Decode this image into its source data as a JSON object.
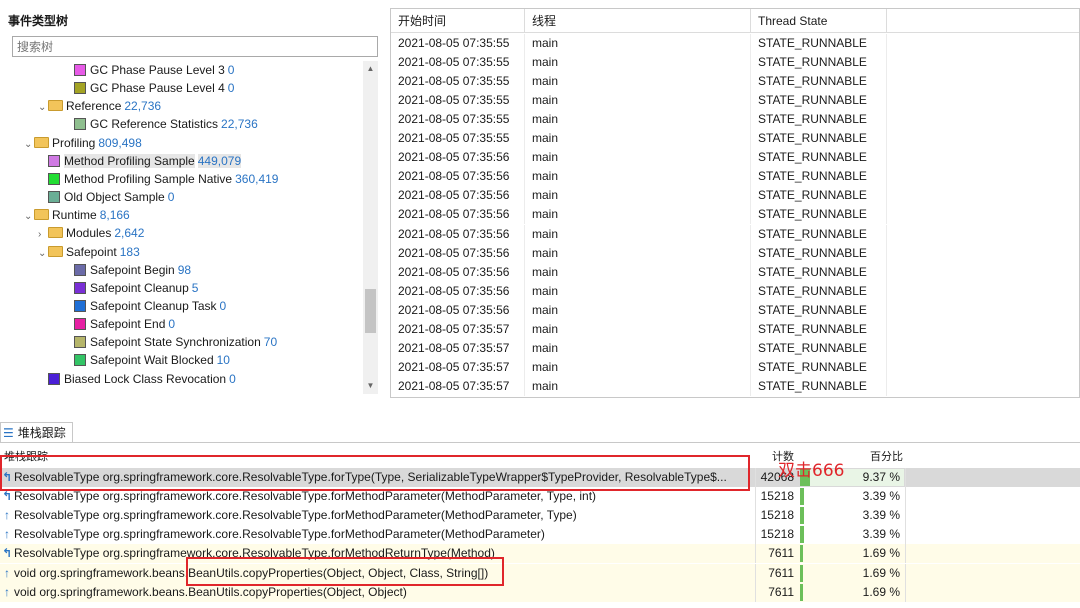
{
  "tree": {
    "title": "事件类型树",
    "search_placeholder": "搜索树",
    "nodes": [
      {
        "indent": 3,
        "kind": "swatch",
        "color": "#e65ae6",
        "label": "GC Phase Pause Level 3",
        "count": "0"
      },
      {
        "indent": 3,
        "kind": "swatch",
        "color": "#a3a324",
        "label": "GC Phase Pause Level 4",
        "count": "0"
      },
      {
        "indent": 2,
        "kind": "folder",
        "arrow": "v",
        "label": "Reference",
        "count": "22,736"
      },
      {
        "indent": 3,
        "kind": "swatch",
        "color": "#8fbf8f",
        "label": "GC Reference Statistics",
        "count": "22,736"
      },
      {
        "indent": 1,
        "kind": "folder",
        "arrow": "v",
        "label": "Profiling",
        "count": "809,498"
      },
      {
        "indent": 2,
        "kind": "swatch",
        "color": "#cf79e3",
        "label": "Method Profiling Sample",
        "count": "449,079",
        "selected": true
      },
      {
        "indent": 2,
        "kind": "swatch",
        "color": "#22dd33",
        "label": "Method Profiling Sample Native",
        "count": "360,419"
      },
      {
        "indent": 2,
        "kind": "swatch",
        "color": "#6aae95",
        "label": "Old Object Sample",
        "count": "0"
      },
      {
        "indent": 1,
        "kind": "folder",
        "arrow": "v",
        "label": "Runtime",
        "count": "8,166"
      },
      {
        "indent": 2,
        "kind": "folder",
        "arrow": ">",
        "label": "Modules",
        "count": "2,642"
      },
      {
        "indent": 2,
        "kind": "folder",
        "arrow": "v",
        "label": "Safepoint",
        "count": "183"
      },
      {
        "indent": 3,
        "kind": "swatch",
        "color": "#6b6ba8",
        "label": "Safepoint Begin",
        "count": "98"
      },
      {
        "indent": 3,
        "kind": "swatch",
        "color": "#7a2fd6",
        "label": "Safepoint Cleanup",
        "count": "5"
      },
      {
        "indent": 3,
        "kind": "swatch",
        "color": "#1f6fd6",
        "label": "Safepoint Cleanup Task",
        "count": "0"
      },
      {
        "indent": 3,
        "kind": "swatch",
        "color": "#e621a3",
        "label": "Safepoint End",
        "count": "0"
      },
      {
        "indent": 3,
        "kind": "swatch",
        "color": "#b5b56a",
        "label": "Safepoint State Synchronization",
        "count": "70"
      },
      {
        "indent": 3,
        "kind": "swatch",
        "color": "#33c466",
        "label": "Safepoint Wait Blocked",
        "count": "10"
      },
      {
        "indent": 2,
        "kind": "swatch",
        "color": "#4a1fd6",
        "label": "Biased Lock Class Revocation",
        "count": "0"
      }
    ]
  },
  "events": {
    "headers": [
      "开始时间",
      "线程",
      "Thread State"
    ],
    "rows": [
      [
        "2021-08-05 07:35:55",
        "main",
        "STATE_RUNNABLE"
      ],
      [
        "2021-08-05 07:35:55",
        "main",
        "STATE_RUNNABLE"
      ],
      [
        "2021-08-05 07:35:55",
        "main",
        "STATE_RUNNABLE"
      ],
      [
        "2021-08-05 07:35:55",
        "main",
        "STATE_RUNNABLE"
      ],
      [
        "2021-08-05 07:35:55",
        "main",
        "STATE_RUNNABLE"
      ],
      [
        "2021-08-05 07:35:55",
        "main",
        "STATE_RUNNABLE"
      ],
      [
        "2021-08-05 07:35:56",
        "main",
        "STATE_RUNNABLE"
      ],
      [
        "2021-08-05 07:35:56",
        "main",
        "STATE_RUNNABLE"
      ],
      [
        "2021-08-05 07:35:56",
        "main",
        "STATE_RUNNABLE"
      ],
      [
        "2021-08-05 07:35:56",
        "main",
        "STATE_RUNNABLE"
      ],
      [
        "2021-08-05 07:35:56",
        "main",
        "STATE_RUNNABLE"
      ],
      [
        "2021-08-05 07:35:56",
        "main",
        "STATE_RUNNABLE"
      ],
      [
        "2021-08-05 07:35:56",
        "main",
        "STATE_RUNNABLE"
      ],
      [
        "2021-08-05 07:35:56",
        "main",
        "STATE_RUNNABLE"
      ],
      [
        "2021-08-05 07:35:56",
        "main",
        "STATE_RUNNABLE"
      ],
      [
        "2021-08-05 07:35:57",
        "main",
        "STATE_RUNNABLE"
      ],
      [
        "2021-08-05 07:35:57",
        "main",
        "STATE_RUNNABLE"
      ],
      [
        "2021-08-05 07:35:57",
        "main",
        "STATE_RUNNABLE"
      ],
      [
        "2021-08-05 07:35:57",
        "main",
        "STATE_RUNNABLE"
      ]
    ]
  },
  "stack": {
    "tab_label": "堆栈跟踪",
    "headers": {
      "trace": "堆栈跟踪",
      "count": "计数",
      "percent": "百分比"
    },
    "rows": [
      {
        "icon": "arrow-split-icon",
        "sig": "ResolvableType org.springframework.core.ResolvableType.forType(Type, SerializableTypeWrapper$TypeProvider, ResolvableType$...",
        "count": "42068",
        "percent": "9.37 %",
        "share": 0.0937,
        "style": "sel"
      },
      {
        "icon": "arrow-split-icon",
        "sig": "ResolvableType org.springframework.core.ResolvableType.forMethodParameter(MethodParameter, Type, int)",
        "count": "15218",
        "percent": "3.39 %",
        "share": 0.0339,
        "style": ""
      },
      {
        "icon": "arrow-up-icon",
        "sig": "ResolvableType org.springframework.core.ResolvableType.forMethodParameter(MethodParameter, Type)",
        "count": "15218",
        "percent": "3.39 %",
        "share": 0.0339,
        "style": ""
      },
      {
        "icon": "arrow-up-icon",
        "sig": "ResolvableType org.springframework.core.ResolvableType.forMethodParameter(MethodParameter)",
        "count": "15218",
        "percent": "3.39 %",
        "share": 0.0339,
        "style": ""
      },
      {
        "icon": "arrow-split-icon",
        "sig": "ResolvableType org.springframework.core.ResolvableType.forMethodReturnType(Method)",
        "count": "7611",
        "percent": "1.69 %",
        "share": 0.0169,
        "style": "yellow"
      },
      {
        "icon": "arrow-up-icon",
        "sig": "void org.springframework.beans.BeanUtils.copyProperties(Object, Object, Class, String[])",
        "count": "7611",
        "percent": "1.69 %",
        "share": 0.0169,
        "style": "yellow"
      },
      {
        "icon": "arrow-up-icon",
        "sig": "void org.springframework.beans.BeanUtils.copyProperties(Object, Object)",
        "count": "7611",
        "percent": "1.69 %",
        "share": 0.0169,
        "style": "yellow"
      }
    ]
  },
  "overlay": {
    "text": "双击666",
    "color": "#e0262b"
  }
}
